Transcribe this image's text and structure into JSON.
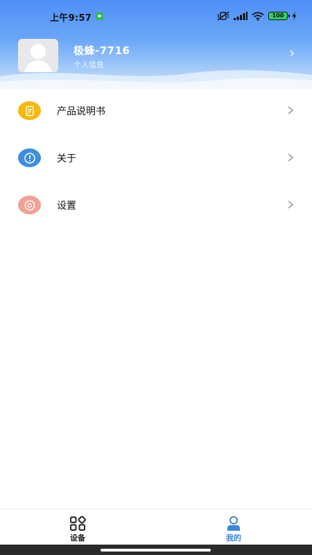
{
  "status_bar": {
    "time": "上午9:57",
    "battery": "100"
  },
  "profile": {
    "name": "极蜂-7716",
    "subtitle": "个人信息"
  },
  "menu": {
    "items": [
      {
        "label": "产品说明书",
        "icon": "document-icon",
        "color": "#f5b80e"
      },
      {
        "label": "关于",
        "icon": "info-icon",
        "color": "#3d8ee0"
      },
      {
        "label": "设置",
        "icon": "gear-icon",
        "color": "#f0a294"
      }
    ]
  },
  "bottom_nav": {
    "items": [
      {
        "label": "设备",
        "icon": "grid-icon",
        "active": false
      },
      {
        "label": "我的",
        "icon": "user-icon",
        "active": true
      }
    ],
    "active_color": "#3b86d6"
  },
  "colors": {
    "header_top": "#4f8ff7",
    "header_bottom": "#d6e8fb"
  }
}
